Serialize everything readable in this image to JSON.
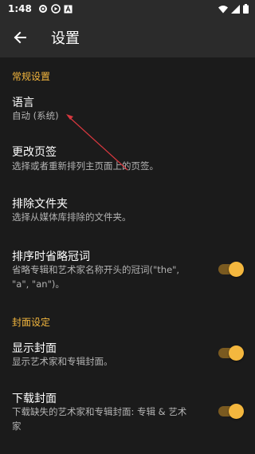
{
  "status_bar": {
    "time": "1:48",
    "icons_left": [
      "settings-icon",
      "circle-icon",
      "a-icon"
    ],
    "icons_right": [
      "wifi-icon",
      "signal-icon",
      "battery-icon"
    ]
  },
  "app_bar": {
    "title": "设置",
    "back_icon": "arrow-left-icon"
  },
  "sections": [
    {
      "header": "常规设置",
      "items": [
        {
          "title": "语言",
          "summary": "自动 (系统)"
        },
        {
          "title": "更改页签",
          "summary": "选择或者重新排列主页面上的页签。"
        },
        {
          "title": "排除文件夹",
          "summary": "选择从媒体库排除的文件夹。"
        },
        {
          "title": "排序时省略冠词",
          "summary_line1": "省略专辑和艺术家名称开头的冠词(\"the\",",
          "summary_line2": "\"a\", \"an\")。",
          "switch_on": true
        }
      ]
    },
    {
      "header": "封面设定",
      "items": [
        {
          "title": "显示封面",
          "summary": "显示艺术家和专辑封面。",
          "switch_on": true
        },
        {
          "title": "下载封面",
          "summary_line1": "下载缺失的艺术家和专辑封面: 专辑 & 艺术",
          "summary_line2": "家",
          "switch_on": true
        }
      ]
    }
  ],
  "colors": {
    "accent": "#f4b73e",
    "background": "#1b1b1b",
    "bar": "#2b2b2b",
    "annotation_arrow": "#d9383f"
  }
}
